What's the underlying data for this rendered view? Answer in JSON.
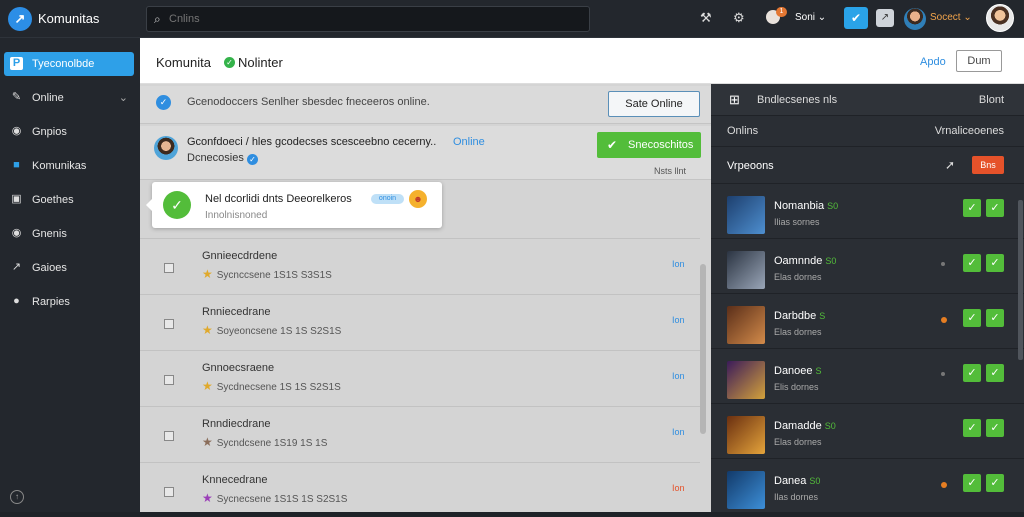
{
  "app": {
    "logo_glyph": "↗",
    "title": "Komunitas"
  },
  "search": {
    "placeholder": "Cnlins",
    "value": ""
  },
  "topbar": {
    "tool_icon": "wrench-icon",
    "settings_icon": "gear-icon",
    "notif_badge": "1",
    "notif_label": "Soni ⌄",
    "user_name": "Socect ⌄"
  },
  "sidebar": {
    "items": [
      {
        "label": "Tyeconolbde",
        "icon": "P",
        "active": true,
        "chevron": ""
      },
      {
        "label": "Online",
        "icon": "✎",
        "active": false,
        "chevron": "⌄"
      },
      {
        "label": "Gnpios",
        "icon": "◉",
        "active": false,
        "chevron": ""
      },
      {
        "label": "Komunikas",
        "icon": "■",
        "active": false,
        "chevron": ""
      },
      {
        "label": "Goethes",
        "icon": "▣",
        "active": false,
        "chevron": ""
      },
      {
        "label": "Gnenis",
        "icon": "◉",
        "active": false,
        "chevron": ""
      },
      {
        "label": "Gaioes",
        "icon": "↗",
        "active": false,
        "chevron": ""
      },
      {
        "label": "Rarpies",
        "icon": "●",
        "active": false,
        "chevron": ""
      }
    ],
    "footer_icon": "↑"
  },
  "page": {
    "title": "Komunita",
    "title_suffix": "Nolinter",
    "header_link": "Apdo",
    "header_button": "Dum"
  },
  "statusbar": {
    "text": "Gcenodoccers Senlher sbesdec fneceeros online.",
    "button": "Sate Online"
  },
  "post": {
    "name": "Gconfdoeci / hles gcodecses scesceebno cecerny..",
    "online": "Online",
    "sub": "Dcnecosies",
    "button": "Snecoschitos",
    "meta": "Nsts llnt"
  },
  "card": {
    "title": "Nel dcorlidi dnts Deeorelkeros",
    "pill": "onoin",
    "emoji": "☻",
    "sub": "Innolnisnoned"
  },
  "rows": [
    {
      "title": "Gnnieecdrdene",
      "star_color": "#e0a92b",
      "sub": "Sycnccsene 1S1S S3S1S",
      "tag": "Ion"
    },
    {
      "title": "Rnniecedrane",
      "star_color": "#e0a92b",
      "sub": "Soyeoncsene 1S 1S S2S1S",
      "tag": "Ion"
    },
    {
      "title": "Gnnoecsraene",
      "star_color": "#e0a92b",
      "sub": "Sycdnecsene 1S 1S S2S1S",
      "tag": "Ion"
    },
    {
      "title": "Rnndiecdrane",
      "star_color": "#8a6d5a",
      "sub": "Sycndcsene 1S19 1S 1S",
      "tag": "Ion"
    },
    {
      "title": "Knnecedrane",
      "star_color": "#9b3fb8",
      "sub": "Sycnecsene 1S1S 1S S2S1S",
      "tag": "Ion"
    }
  ],
  "right_panel": {
    "grid_icon": "⊞",
    "header_title": "Bndlecsenes nls",
    "header_right": "Blont",
    "sub_left": "Onlins",
    "sub_right": "Vrnaliceoenes",
    "section_title": "Vrpeoons",
    "section_button": "Bns",
    "games": [
      {
        "title": "Nomanbia",
        "num": "S0",
        "sub": "Ilias sornes",
        "thumb_colors": [
          "#1d3f6e",
          "#4e8fd0"
        ],
        "dot": ""
      },
      {
        "title": "Oamnnde",
        "num": "S0",
        "sub": "Elas dornes",
        "thumb_colors": [
          "#2b3442",
          "#9aa6b8"
        ],
        "dot": "#777"
      },
      {
        "title": "Darbdbe",
        "num": "S",
        "sub": "Elas dornes",
        "thumb_colors": [
          "#5a2e19",
          "#d38b4a"
        ],
        "dot": "#e67e22"
      },
      {
        "title": "Danoee",
        "num": "S",
        "sub": "Elis dornes",
        "thumb_colors": [
          "#3b1b5a",
          "#d4a23b"
        ],
        "dot": "#777"
      },
      {
        "title": "Damadde",
        "num": "S0",
        "sub": "Elas dornes",
        "thumb_colors": [
          "#6a2f10",
          "#e5a43b"
        ],
        "dot": "#777"
      },
      {
        "title": "Danea",
        "num": "S0",
        "sub": "Ilas dornes",
        "thumb_colors": [
          "#123a6a",
          "#3d8fd8"
        ],
        "dot": "#e67e22"
      }
    ]
  },
  "colors": {
    "accent": "#2ea0e8",
    "success": "#53bd3a",
    "danger": "#e5522a"
  }
}
